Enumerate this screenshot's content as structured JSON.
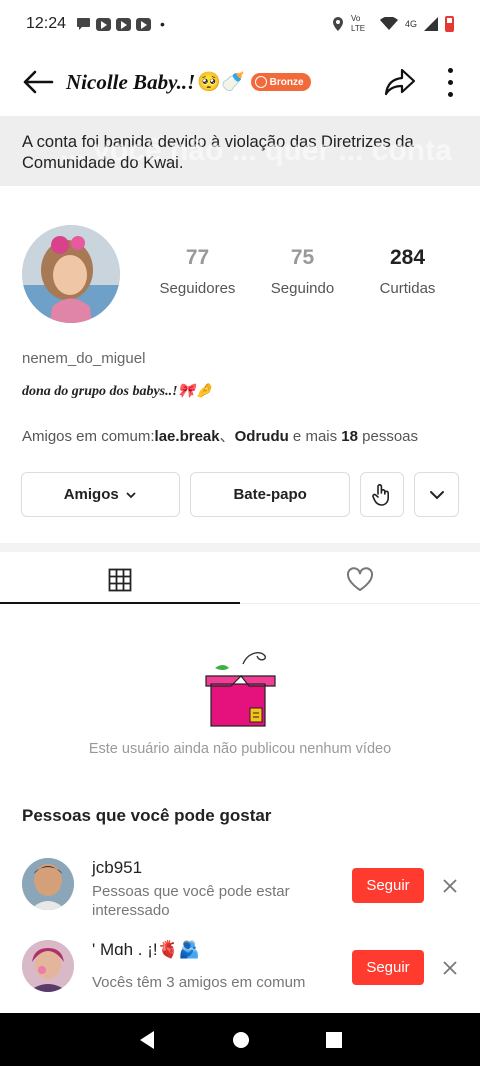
{
  "status_bar": {
    "time": "12:24",
    "notifications": [
      "chat-icon",
      "youtube-icon",
      "youtube-icon",
      "youtube-icon"
    ],
    "dot": "•",
    "network_label": "Vo LTE",
    "signal_label": "4G"
  },
  "header": {
    "title": "Nicolle Baby..!",
    "title_emoji": "🥺🍼",
    "badge_label": "Bronze"
  },
  "ban_notice": {
    "text": "A conta foi banida devido à violação das Diretrizes da Comunidade do Kwai.",
    "ghost_text": "... você não ... quer ... conta"
  },
  "profile": {
    "stats": [
      {
        "value": "77",
        "label": "Seguidores"
      },
      {
        "value": "75",
        "label": "Seguindo"
      },
      {
        "value": "284",
        "label": "Curtidas"
      }
    ],
    "username": "nenem_do_miguel",
    "bio": "dona do grupo dos babys..!🎀🤌",
    "mutual_prefix": "Amigos em comum:",
    "mutual_friend_1": "lae.break",
    "mutual_sep": "、",
    "mutual_friend_2": "Odrudu",
    "mutual_mid": " e mais ",
    "mutual_count": "18",
    "mutual_suffix": " pessoas"
  },
  "actions": {
    "friends_label": "Amigos",
    "chat_label": "Bate-papo"
  },
  "tabs": [
    {
      "icon": "grid-icon",
      "active": true
    },
    {
      "icon": "heart-icon",
      "active": false
    }
  ],
  "empty_state": {
    "text": "Este usuário ainda não publicou nenhum vídeo"
  },
  "suggestions": {
    "title": "Pessoas que você pode gostar",
    "follow_label": "Seguir",
    "items": [
      {
        "name": "jcb951",
        "subtitle": "Pessoas que você pode estar interessado"
      },
      {
        "name": "' Mɑh . ¡!🫀🫂",
        "subtitle": "Vocês têm 3 amigos em comum"
      }
    ]
  },
  "colors": {
    "accent": "#ff3b30",
    "badge": "#f26a3a",
    "banner_bg": "#eeeeee"
  }
}
